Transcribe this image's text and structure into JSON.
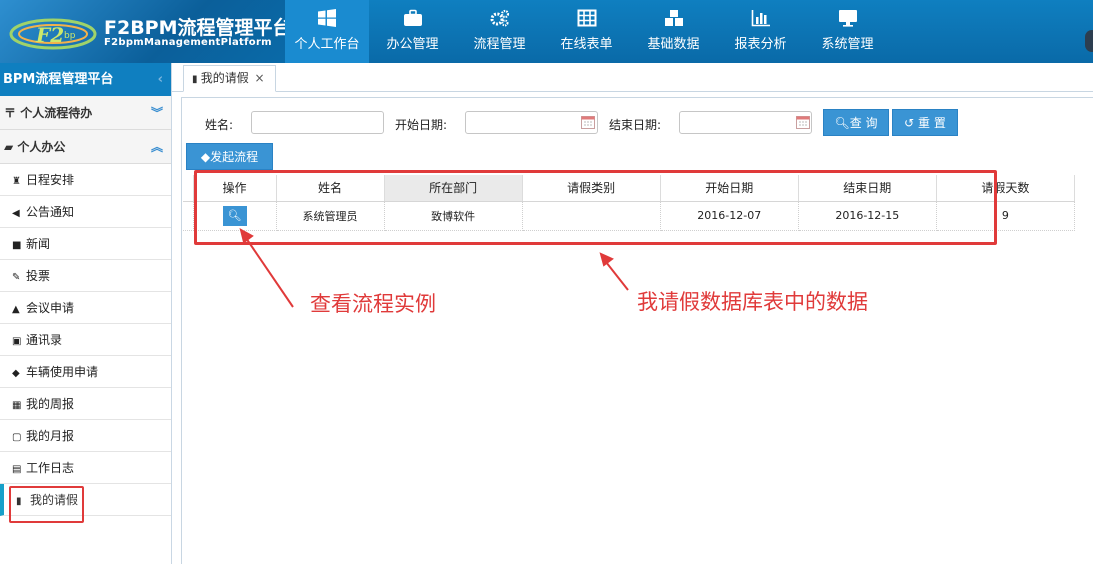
{
  "header": {
    "logo_title": "F2BPM流程管理平台",
    "logo_subtitle": "F2bpmManagementPlatform",
    "nav": [
      {
        "label": "个人工作台",
        "icon": "windows-icon"
      },
      {
        "label": "办公管理",
        "icon": "briefcase-icon"
      },
      {
        "label": "流程管理",
        "icon": "gears-icon"
      },
      {
        "label": "在线表单",
        "icon": "table-icon"
      },
      {
        "label": "基础数据",
        "icon": "cubes-icon"
      },
      {
        "label": "报表分析",
        "icon": "bar-chart-icon"
      },
      {
        "label": "系统管理",
        "icon": "monitor-icon"
      }
    ]
  },
  "sidebar": {
    "title": "BPM流程管理平台",
    "group1": "个人流程待办",
    "group2": "个人办公",
    "items": [
      {
        "label": "日程安排",
        "icon": "sitemap-icon"
      },
      {
        "label": "公告通知",
        "icon": "bullhorn-icon"
      },
      {
        "label": "新闻",
        "icon": "folder-icon"
      },
      {
        "label": "投票",
        "icon": "vote-icon"
      },
      {
        "label": "会议申请",
        "icon": "graduation-cap-icon"
      },
      {
        "label": "通讯录",
        "icon": "contact-book-icon"
      },
      {
        "label": "车辆使用申请",
        "icon": "car-icon"
      },
      {
        "label": "我的周报",
        "icon": "calendar-icon"
      },
      {
        "label": "我的月报",
        "icon": "calendar-icon"
      },
      {
        "label": "工作日志",
        "icon": "log-icon"
      },
      {
        "label": "我的请假",
        "icon": "file-icon"
      }
    ]
  },
  "tab": {
    "label": "我的请假",
    "close": "×"
  },
  "search": {
    "name_label": "姓名:",
    "start_label": "开始日期:",
    "end_label": "结束日期:",
    "query_label": "查 询",
    "reset_label": "重 置",
    "launch_label": "发起流程"
  },
  "table": {
    "headers": [
      "操作",
      "姓名",
      "所在部门",
      "请假类别",
      "开始日期",
      "结束日期",
      "请假天数"
    ],
    "rows": [
      {
        "name": "系统管理员",
        "dept": "致博软件",
        "type": "",
        "start": "2016-12-07",
        "end": "2016-12-15",
        "days": "9"
      }
    ]
  },
  "annotations": {
    "view": "查看流程实例",
    "data": "我请假数据库表中的数据"
  },
  "colors": {
    "brand": "#0f7fc0",
    "button": "#3a94d4",
    "annotation": "#e03a3a"
  }
}
